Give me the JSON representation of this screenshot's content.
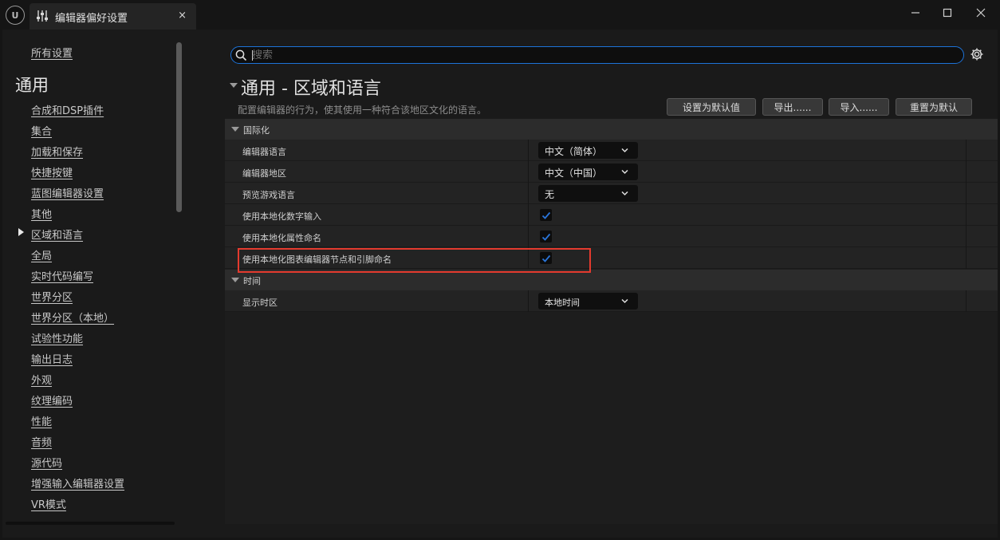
{
  "window": {
    "tab_title": "编辑器偏好设置",
    "tab_close": "×",
    "minimize": "—",
    "maximize": "☐",
    "close": "✕"
  },
  "sidebar": {
    "all_settings": "所有设置",
    "heading": "通用",
    "active_item": "区域和语言",
    "items": [
      {
        "label": "合成和DSP插件"
      },
      {
        "label": "集合"
      },
      {
        "label": "加载和保存"
      },
      {
        "label": "快捷按键"
      },
      {
        "label": "蓝图编辑器设置"
      },
      {
        "label": "其他"
      },
      {
        "label": "区域和语言"
      },
      {
        "label": "全局"
      },
      {
        "label": "实时代码编写"
      },
      {
        "label": "世界分区"
      },
      {
        "label": "世界分区（本地）"
      },
      {
        "label": "试验性功能"
      },
      {
        "label": "输出日志"
      },
      {
        "label": "外观"
      },
      {
        "label": "纹理编码"
      },
      {
        "label": "性能"
      },
      {
        "label": "音频"
      },
      {
        "label": "源代码"
      },
      {
        "label": "增强输入编辑器设置"
      },
      {
        "label": "VR模式"
      }
    ]
  },
  "search": {
    "placeholder": "搜索",
    "value": ""
  },
  "category": {
    "title": "通用 - 区域和语言",
    "description": "配置编辑器的行为，使其使用一种符合该地区文化的语言。",
    "buttons": {
      "set_default": "设置为默认值",
      "export": "导出......",
      "import": "导入......",
      "reset_default": "重置为默认"
    }
  },
  "sections": {
    "internationalization": {
      "label": "国际化",
      "rows": {
        "editor_language": {
          "label": "编辑器语言",
          "value": "中文（简体）"
        },
        "editor_region": {
          "label": "编辑器地区",
          "value": "中文（中国）"
        },
        "preview_game_language": {
          "label": "预览游戏语言",
          "value": "无"
        },
        "localized_numeric_input": {
          "label": "使用本地化数字输入",
          "checked": true
        },
        "localized_property_names": {
          "label": "使用本地化属性命名",
          "checked": true
        },
        "localized_graph_names": {
          "label": "使用本地化图表编辑器节点和引脚命名",
          "checked": true
        }
      }
    },
    "time": {
      "label": "时间",
      "rows": {
        "display_timezone": {
          "label": "显示时区",
          "value": "本地时间"
        }
      }
    }
  },
  "colors": {
    "accent": "#1d73d9",
    "checkbox": "#2a74d8",
    "highlight": "#e43a2e",
    "background": "#1a1a1a"
  }
}
